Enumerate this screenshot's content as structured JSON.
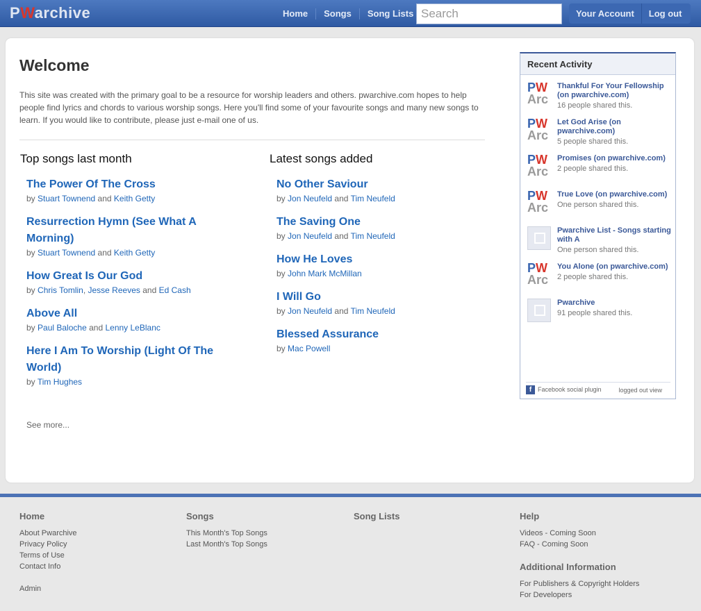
{
  "header": {
    "logo": {
      "p": "P",
      "w": "W",
      "rest": "archive"
    },
    "nav": [
      "Home",
      "Songs",
      "Song Lists"
    ],
    "search_placeholder": "Search",
    "account": "Your Account",
    "logout": "Log out"
  },
  "main": {
    "title": "Welcome",
    "intro": "This site was created with the primary goal to be a resource for worship leaders and others. pwarchive.com hopes to help people find lyrics and chords to various worship songs. Here you'll find some of your favourite songs and many new songs to learn. If you would like to contribute, please just e-mail one of us.",
    "top_title": "Top songs last month",
    "latest_title": "Latest songs added",
    "by": "by",
    "and": "and",
    "see_more": "See more..."
  },
  "top_songs": [
    {
      "title": "The Power Of The Cross",
      "authors": [
        "Stuart Townend",
        "Keith Getty"
      ]
    },
    {
      "title": "Resurrection Hymn (See What A Morning)",
      "authors": [
        "Stuart Townend",
        "Keith Getty"
      ]
    },
    {
      "title": "How Great Is Our God",
      "authors": [
        "Chris Tomlin",
        "Jesse Reeves",
        "Ed Cash"
      ]
    },
    {
      "title": "Above All",
      "authors": [
        "Paul Baloche",
        "Lenny LeBlanc"
      ]
    },
    {
      "title": "Here I Am To Worship (Light Of The World)",
      "authors": [
        "Tim Hughes"
      ]
    }
  ],
  "latest_songs": [
    {
      "title": "No Other Saviour",
      "authors": [
        "Jon Neufeld",
        "Tim Neufeld"
      ]
    },
    {
      "title": "The Saving One",
      "authors": [
        "Jon Neufeld",
        "Tim Neufeld"
      ]
    },
    {
      "title": "How He Loves",
      "authors": [
        "John Mark McMillan"
      ]
    },
    {
      "title": "I Will Go",
      "authors": [
        "Jon Neufeld",
        "Tim Neufeld"
      ]
    },
    {
      "title": "Blessed Assurance",
      "authors": [
        "Mac Powell"
      ]
    }
  ],
  "recent_activity": {
    "title": "Recent Activity",
    "thumb_pw": {
      "p": "P",
      "w": "W"
    },
    "thumb_arc": "Arc",
    "items": [
      {
        "title": "Thankful For Your Fellowship (on pwarchive.com)",
        "count": "16 people shared this.",
        "thumb": "logo"
      },
      {
        "title": "Let God Arise (on pwarchive.com)",
        "count": "5 people shared this.",
        "thumb": "logo"
      },
      {
        "title": "Promises (on pwarchive.com)",
        "count": "2 people shared this.",
        "thumb": "logo"
      },
      {
        "title": "True Love (on pwarchive.com)",
        "count": "One person shared this.",
        "thumb": "logo"
      },
      {
        "title": "Pwarchive List - Songs starting with A",
        "count": "One person shared this.",
        "thumb": "blank"
      },
      {
        "title": "You Alone (on pwarchive.com)",
        "count": "2 people shared this.",
        "thumb": "logo"
      },
      {
        "title": "Pwarchive",
        "count": "91 people shared this.",
        "thumb": "blank"
      }
    ],
    "plugin": "Facebook social plugin",
    "view": "logged out view"
  },
  "footer": [
    {
      "heading": "Home",
      "links": [
        "About Pwarchive",
        "Privacy Policy",
        "Terms of Use",
        "Contact Info",
        "",
        "Admin"
      ]
    },
    {
      "heading": "Songs",
      "links": [
        "This Month's Top Songs",
        "Last Month's Top Songs"
      ]
    },
    {
      "heading": "Song Lists",
      "links": []
    },
    {
      "heading": "Help",
      "links": [
        "Videos - Coming Soon",
        "FAQ - Coming Soon"
      ]
    }
  ],
  "footer_extra": {
    "heading": "Additional Information",
    "links": [
      "For Publishers & Copyright Holders",
      "For Developers"
    ]
  },
  "colors": {
    "header": "#2f5aa3",
    "link": "#1f66b8",
    "accent_red": "#d8362c"
  }
}
